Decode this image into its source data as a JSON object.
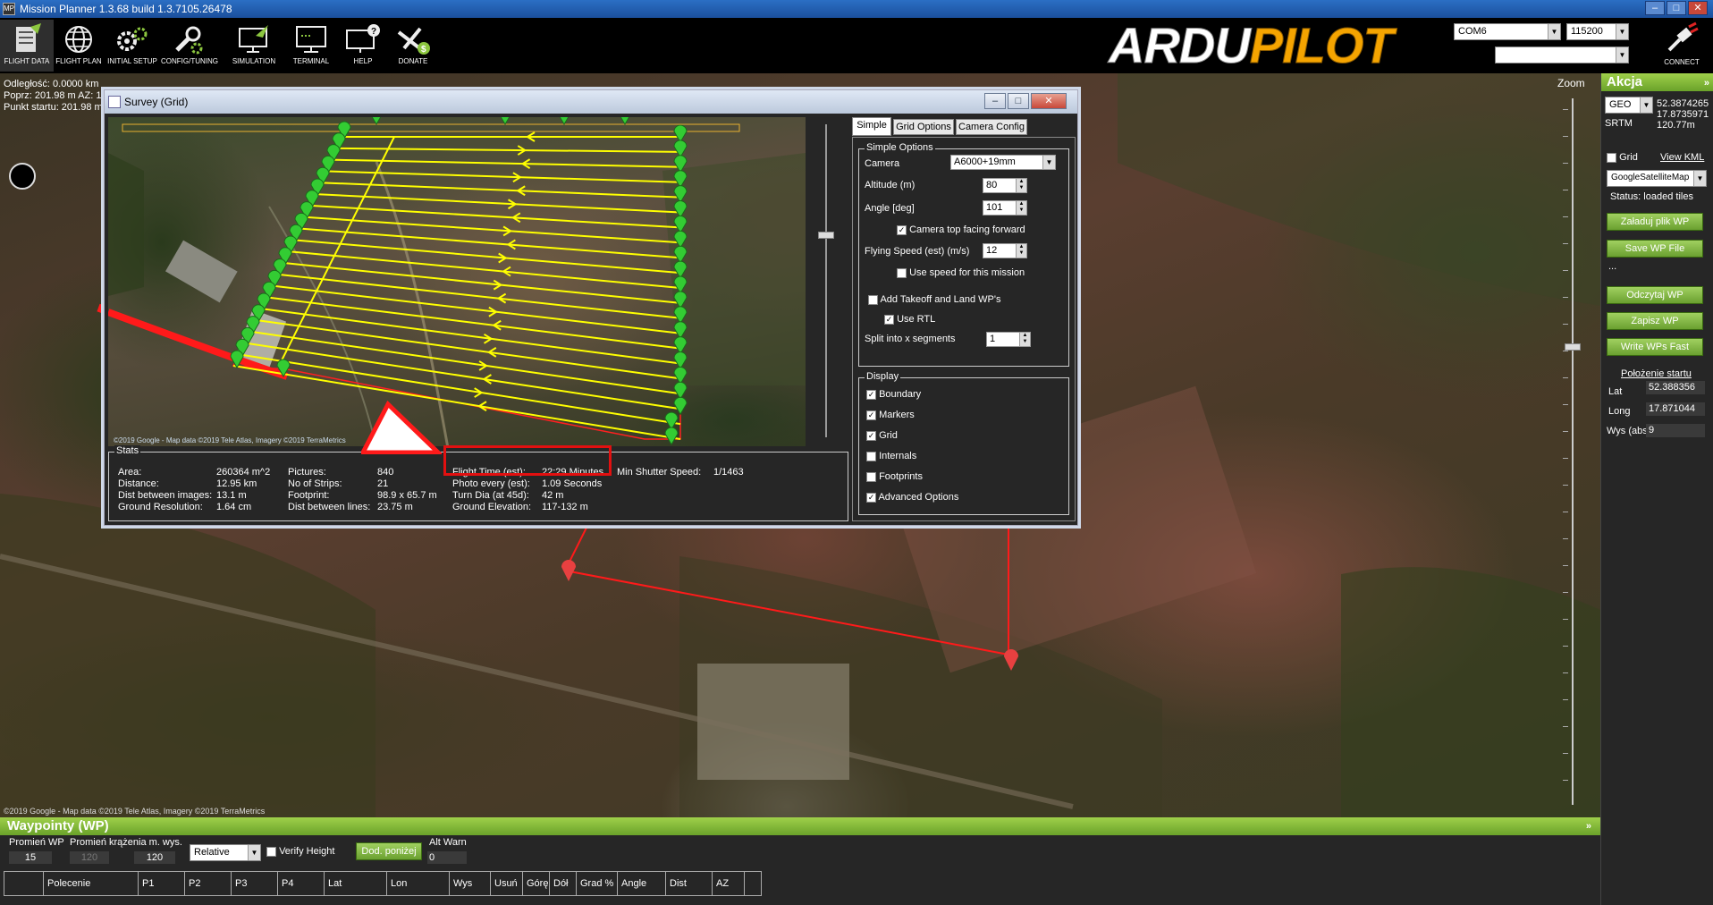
{
  "window": {
    "title": "Mission Planner 1.3.68 build 1.3.7105.26478",
    "app_icon": "MP",
    "controls": [
      "–",
      "□",
      "✕"
    ]
  },
  "toolbar": {
    "buttons": [
      {
        "label": "FLIGHT DATA",
        "icon": "flight-data-icon"
      },
      {
        "label": "FLIGHT PLAN",
        "icon": "globe-icon"
      },
      {
        "label": "INITIAL SETUP",
        "icon": "gears-icon"
      },
      {
        "label": "CONFIG/TUNING",
        "icon": "wrench-icon"
      },
      {
        "label": "SIMULATION",
        "icon": "monitor-plane-icon"
      },
      {
        "label": "TERMINAL",
        "icon": "terminal-icon"
      },
      {
        "label": "HELP",
        "icon": "help-icon"
      },
      {
        "label": "DONATE",
        "icon": "donate-icon"
      }
    ],
    "logo": {
      "part1": "ARDU",
      "part2": "PILOT"
    },
    "port": "COM6",
    "baud": "115200",
    "second_select": "",
    "connect_label": "CONNECT"
  },
  "map": {
    "overlay": {
      "line1": "Odległość: 0.0000 km",
      "line2": "Poprz: 201.98 m AZ: 1",
      "line3": "Punkt startu: 201.98 m"
    },
    "attribution": "©2019 Google - Map data ©2019 Tele Atlas, Imagery ©2019 TerraMetrics",
    "zoom_label": "Zoom"
  },
  "right_panel": {
    "title": "Akcja",
    "chevron": "»",
    "coord_mode": "GEO",
    "lat": "52.3874265",
    "lon": "17.8735971",
    "alt": "120.77m",
    "srtm_label": "SRTM",
    "grid_label": "Grid",
    "view_kml": "View KML",
    "map_provider": "GoogleSatelliteMap",
    "status": "Status: loaded tiles",
    "load_wp_file": "Załaduj plik WP",
    "save_wp_file": "Save WP File",
    "dots": "...",
    "read_wp": "Odczytaj WP",
    "write_wp": "Zapisz WP",
    "write_wp_fast": "Write WPs Fast",
    "home_title": "Położenie startu",
    "home_lat_label": "Lat",
    "home_lat": "52.388356",
    "home_long_label": "Long",
    "home_long": "17.871044",
    "home_alt_label": "Wys (abs)",
    "home_alt": "9"
  },
  "waypoints_panel": {
    "title": "Waypointy (WP)",
    "chevron": "»",
    "radius_label": "Promień WP",
    "radius": "15",
    "loiter_label": "Promień krążenia m. wys.",
    "loiter": "120",
    "default_alt": "120",
    "alt_mode": "Relative",
    "verify_height": "Verify Height",
    "add_below": "Dod. poniżej",
    "alt_warn_label": "Alt Warn",
    "alt_warn": "0",
    "columns": [
      "",
      "Polecenie",
      "P1",
      "P2",
      "P3",
      "P4",
      "Lat",
      "Lon",
      "Wys",
      "Usuń",
      "Górę",
      "Dół",
      "Grad %",
      "Angle",
      "Dist",
      "AZ"
    ]
  },
  "survey": {
    "title": "Survey (Grid)",
    "attribution": "©2019 Google - Map data ©2019 Tele Atlas, Imagery ©2019 TerraMetrics",
    "stats_title": "Stats",
    "stats": {
      "area_label": "Area:",
      "area": "260364 m^2",
      "distance_label": "Distance:",
      "distance": "12.95 km",
      "dist_images_label": "Dist between images:",
      "dist_images": "13.1 m",
      "gsd_label": "Ground Resolution:",
      "gsd": "1.64 cm",
      "pictures_label": "Pictures:",
      "pictures": "840",
      "strips_label": "No of Strips:",
      "strips": "21",
      "footprint_label": "Footprint:",
      "footprint": "98.9 x 65.7 m",
      "dist_lines_label": "Dist between lines:",
      "dist_lines": "23.75 m",
      "flight_time_label": "Flight Time (est):",
      "flight_time": "22:29 Minutes",
      "photo_every_label": "Photo every (est):",
      "photo_every": "1.09 Seconds",
      "turn_dia_label": "Turn Dia (at 45d):",
      "turn_dia": "42 m",
      "ground_elev_label": "Ground Elevation:",
      "ground_elev": "117-132 m",
      "shutter_label": "Min Shutter Speed:",
      "shutter": "1/1463"
    },
    "tabs": [
      "Simple",
      "Grid Options",
      "Camera Config"
    ],
    "simple_options_title": "Simple Options",
    "camera_label": "Camera",
    "camera": "A6000+19mm",
    "altitude_label": "Altitude (m)",
    "altitude": "80",
    "angle_label": "Angle [deg]",
    "angle": "101",
    "camera_top_forward": "Camera top facing forward",
    "flying_speed_label": "Flying Speed (est) (m/s)",
    "flying_speed": "12",
    "use_speed": "Use speed for this mission",
    "add_takeoff_land": "Add Takeoff and Land WP's",
    "use_rtl": "Use RTL",
    "split_label": "Split into x segments",
    "split": "1",
    "display_title": "Display",
    "display_items": [
      {
        "label": "Boundary",
        "checked": true
      },
      {
        "label": "Markers",
        "checked": true
      },
      {
        "label": "Grid",
        "checked": true
      },
      {
        "label": "Internals",
        "checked": false
      },
      {
        "label": "Footprints",
        "checked": false
      },
      {
        "label": "Advanced Options",
        "checked": true
      }
    ]
  },
  "colors": {
    "accent_green": "#8cc63f",
    "grid_line_yellow": "#ffff00",
    "marker_green": "#33cc33",
    "highlight_red": "#e21010"
  }
}
